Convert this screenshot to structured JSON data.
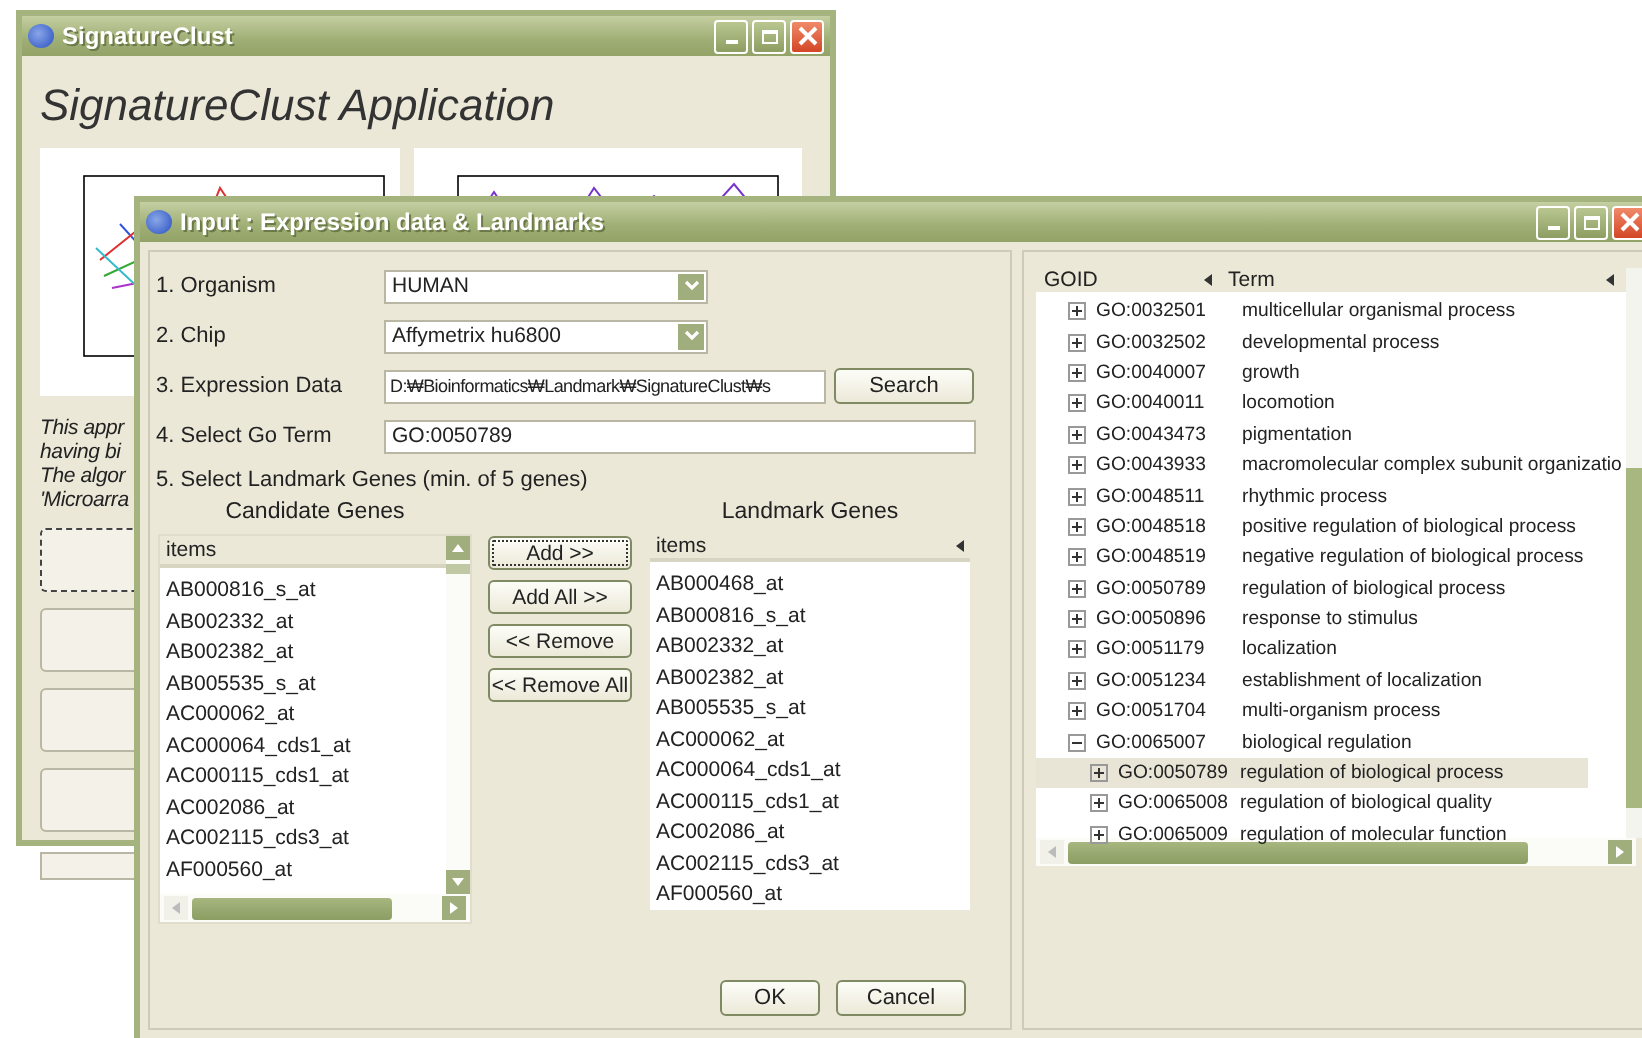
{
  "back_window": {
    "title": "SignatureClust",
    "heading": "SignatureClust Application",
    "description_lines": [
      "This appr",
      "having bi",
      "The algor",
      "'Microarra"
    ]
  },
  "dialog": {
    "title": "Input : Expression data & Landmarks",
    "form": [
      {
        "kind": "select",
        "label": "1. Organism",
        "value": "HUMAN"
      },
      {
        "kind": "select",
        "label": "2. Chip",
        "value": "Affymetrix hu6800"
      },
      {
        "kind": "file",
        "label": "3. Expression Data",
        "value": "D:₩Bioinformatics₩Landmark₩SignatureClust₩s",
        "button": "Search"
      },
      {
        "kind": "text",
        "label": "4. Select Go Term",
        "value": "GO:0050789"
      }
    ],
    "landmark_prompt": "5. Select Landmark Genes (min. of 5 genes)",
    "candidate": {
      "heading": "Candidate Genes",
      "column": "items",
      "items": [
        "AB000816_s_at",
        "AB002332_at",
        "AB002382_at",
        "AB005535_s_at",
        "AC000062_at",
        "AC000064_cds1_at",
        "AC000115_cds1_at",
        "AC002086_at",
        "AC002115_cds3_at",
        "AF000560_at"
      ]
    },
    "move_buttons": [
      {
        "label": "Add >>",
        "focused": true
      },
      {
        "label": "Add All >>",
        "focused": false
      },
      {
        "label": "<< Remove",
        "focused": false
      },
      {
        "label": "<< Remove All",
        "focused": false
      }
    ],
    "landmark": {
      "heading": "Landmark Genes",
      "column": "items",
      "items": [
        "AB000468_at",
        "AB000816_s_at",
        "AB002332_at",
        "AB002382_at",
        "AB005535_s_at",
        "AC000062_at",
        "AC000064_cds1_at",
        "AC000115_cds1_at",
        "AC002086_at",
        "AC002115_cds3_at",
        "AF000560_at"
      ]
    },
    "actions": [
      "OK",
      "Cancel"
    ],
    "go_tree": {
      "columns": [
        "GOID",
        "Term"
      ],
      "rows": [
        {
          "id": "GO:0032501",
          "term": "multicellular organismal process",
          "expanded": false,
          "selected": false
        },
        {
          "id": "GO:0032502",
          "term": "developmental process",
          "expanded": false,
          "selected": false
        },
        {
          "id": "GO:0040007",
          "term": "growth",
          "expanded": false,
          "selected": false
        },
        {
          "id": "GO:0040011",
          "term": "locomotion",
          "expanded": false,
          "selected": false
        },
        {
          "id": "GO:0043473",
          "term": "pigmentation",
          "expanded": false,
          "selected": false
        },
        {
          "id": "GO:0043933",
          "term": "macromolecular complex subunit organizatio",
          "expanded": false,
          "selected": false
        },
        {
          "id": "GO:0048511",
          "term": "rhythmic process",
          "expanded": false,
          "selected": false
        },
        {
          "id": "GO:0048518",
          "term": "positive regulation of biological process",
          "expanded": false,
          "selected": false
        },
        {
          "id": "GO:0048519",
          "term": "negative regulation of biological process",
          "expanded": false,
          "selected": false
        },
        {
          "id": "GO:0050789",
          "term": "regulation of biological process",
          "expanded": false,
          "selected": false
        },
        {
          "id": "GO:0050896",
          "term": "response to stimulus",
          "expanded": false,
          "selected": false
        },
        {
          "id": "GO:0051179",
          "term": "localization",
          "expanded": false,
          "selected": false
        },
        {
          "id": "GO:0051234",
          "term": "establishment of localization",
          "expanded": false,
          "selected": false
        },
        {
          "id": "GO:0051704",
          "term": "multi-organism process",
          "expanded": false,
          "selected": false
        },
        {
          "id": "GO:0065007",
          "term": "biological regulation",
          "expanded": true,
          "selected": false,
          "children": [
            {
              "id": "GO:0050789",
              "term": "regulation of biological process",
              "expanded": false,
              "selected": true
            },
            {
              "id": "GO:0065008",
              "term": "regulation of biological quality",
              "expanded": false,
              "selected": false
            },
            {
              "id": "GO:0065009",
              "term": "regulation of molecular function",
              "expanded": false,
              "selected": false
            }
          ]
        }
      ]
    }
  }
}
